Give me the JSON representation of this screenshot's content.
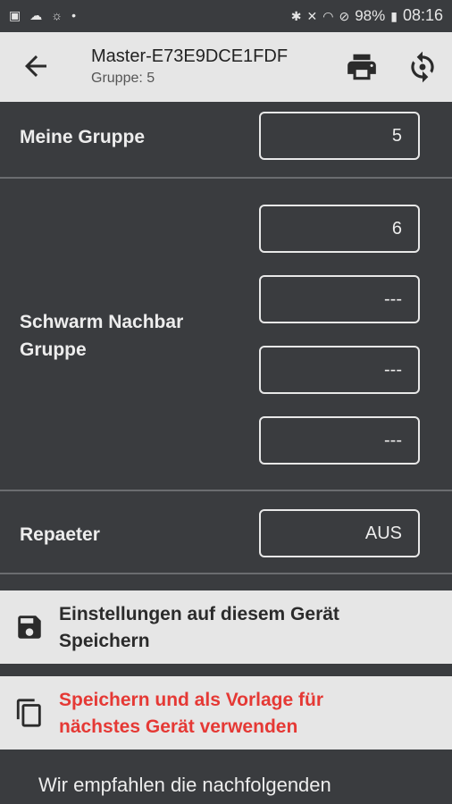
{
  "status_bar": {
    "battery": "98%",
    "time": "08:16"
  },
  "header": {
    "title": "Master-E73E9DCE1FDF",
    "subtitle": "Gruppe:  5",
    "back_icon": "arrow-back-icon",
    "print_icon": "print-icon",
    "sync_icon": "sync-icon"
  },
  "meine_gruppe": {
    "label": "Meine Gruppe",
    "value": "5"
  },
  "schwarm": {
    "label": "Schwarm Nachbar Gruppe",
    "values": [
      "6",
      "---",
      "---",
      "---"
    ]
  },
  "repeater": {
    "label": "Repaeter",
    "value": "AUS"
  },
  "actions": {
    "save_label": "Einstellungen auf diesem Gerät Speichern",
    "template_label": "Speichern und als Vorlage für nächstes Gerät verwenden",
    "template_color": "#e53935"
  },
  "footer": {
    "text": "Wir empfahlen die nachfolgenden"
  }
}
